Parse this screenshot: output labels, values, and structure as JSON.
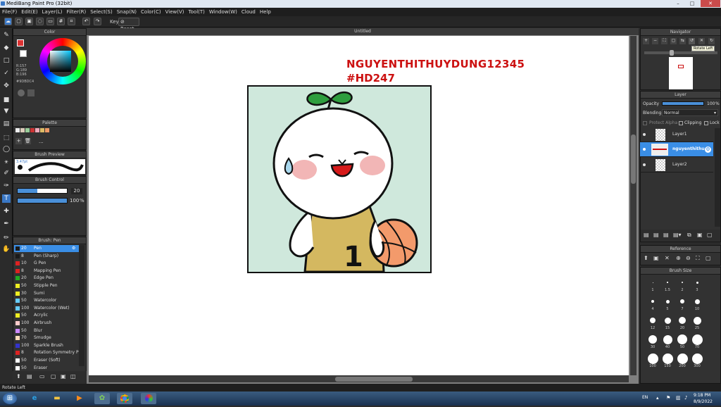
{
  "window": {
    "title": "MediBang Paint Pro (32bit)"
  },
  "menu": [
    "File(F)",
    "Edit(E)",
    "Layer(L)",
    "Filter(R)",
    "Select(S)",
    "Snap(N)",
    "Color(C)",
    "View(V)",
    "Tool(T)",
    "Window(W)",
    "Cloud",
    "Help"
  ],
  "toolbar": {
    "key_label": "Key",
    "reset_label": "Reset"
  },
  "document": {
    "title": "Untitled",
    "text_line1": "NGUYENTHITHUYDUNG12345",
    "text_line2": "#HD247",
    "jersey_number": "1"
  },
  "color_panel": {
    "title": "Color",
    "r": "R:157",
    "g": "G:189",
    "b": "B:196",
    "hex": "#9DBDC4"
  },
  "palette": {
    "title": "Palette",
    "more": "..."
  },
  "brush_preview": {
    "title": "Brush Preview",
    "size": "3.47pt"
  },
  "brush_control": {
    "title": "Brush Control",
    "size_value": "20",
    "opacity_value": "100",
    "opacity_unit": "%"
  },
  "brush_list": {
    "title": "Brush: Pen",
    "items": [
      {
        "size": "20",
        "name": "Pen",
        "color": "#1a1a1a"
      },
      {
        "size": "8",
        "name": "Pen (Sharp)",
        "color": "#1a1a1a"
      },
      {
        "size": "10",
        "name": "G Pen",
        "color": "#d22"
      },
      {
        "size": "8",
        "name": "Mapping Pen",
        "color": "#d22"
      },
      {
        "size": "20",
        "name": "Edge Pen",
        "color": "#2a2"
      },
      {
        "size": "50",
        "name": "Stipple Pen",
        "color": "#ee2"
      },
      {
        "size": "30",
        "name": "Sumi",
        "color": "#ee2"
      },
      {
        "size": "50",
        "name": "Watercolor",
        "color": "#6cf"
      },
      {
        "size": "100",
        "name": "Watercolor (Wet)",
        "color": "#6cf"
      },
      {
        "size": "50",
        "name": "Acrylic",
        "color": "#ee2"
      },
      {
        "size": "100",
        "name": "Airbrush",
        "color": "#fcc"
      },
      {
        "size": "50",
        "name": "Blur",
        "color": "#c8f"
      },
      {
        "size": "70",
        "name": "Smudge",
        "color": "#fdb"
      },
      {
        "size": "100",
        "name": "Sparkle Brush",
        "color": "#33c"
      },
      {
        "size": "8",
        "name": "Rotation Symmetry P",
        "color": "#d22"
      },
      {
        "size": "50",
        "name": "Eraser (Soft)",
        "color": "#fff"
      },
      {
        "size": "50",
        "name": "Eraser",
        "color": "#fff"
      }
    ]
  },
  "navigator": {
    "title": "Navigator",
    "tooltip": "Rotate Left"
  },
  "layer_panel": {
    "title": "Layer",
    "opacity_label": "Opacity",
    "opacity_value": "100",
    "opacity_unit": "%",
    "blending_label": "Blending",
    "blending_value": "Normal",
    "protect_alpha": "Protect Alpha",
    "clipping": "Clipping",
    "lock": "Lock",
    "layers": [
      {
        "name": "Layer1"
      },
      {
        "name": "nguyenthithu"
      },
      {
        "name": "Layer2"
      }
    ]
  },
  "reference": {
    "title": "Reference"
  },
  "brush_size": {
    "title": "Brush Size",
    "labels": [
      "1",
      "1.5",
      "2",
      "3",
      "4",
      "5",
      "7",
      "10",
      "12",
      "15",
      "20",
      "25",
      "30",
      "40",
      "50",
      "70",
      "100",
      "150",
      "200",
      "300"
    ]
  },
  "status": {
    "text": "Rotate Left"
  },
  "taskbar": {
    "lang": "EN",
    "time": "9:18 PM",
    "date": "8/9/2022"
  },
  "colors": {
    "accent": "#4a90d9",
    "selected_row": "#3a8ee6",
    "text_red": "#cc1111"
  }
}
